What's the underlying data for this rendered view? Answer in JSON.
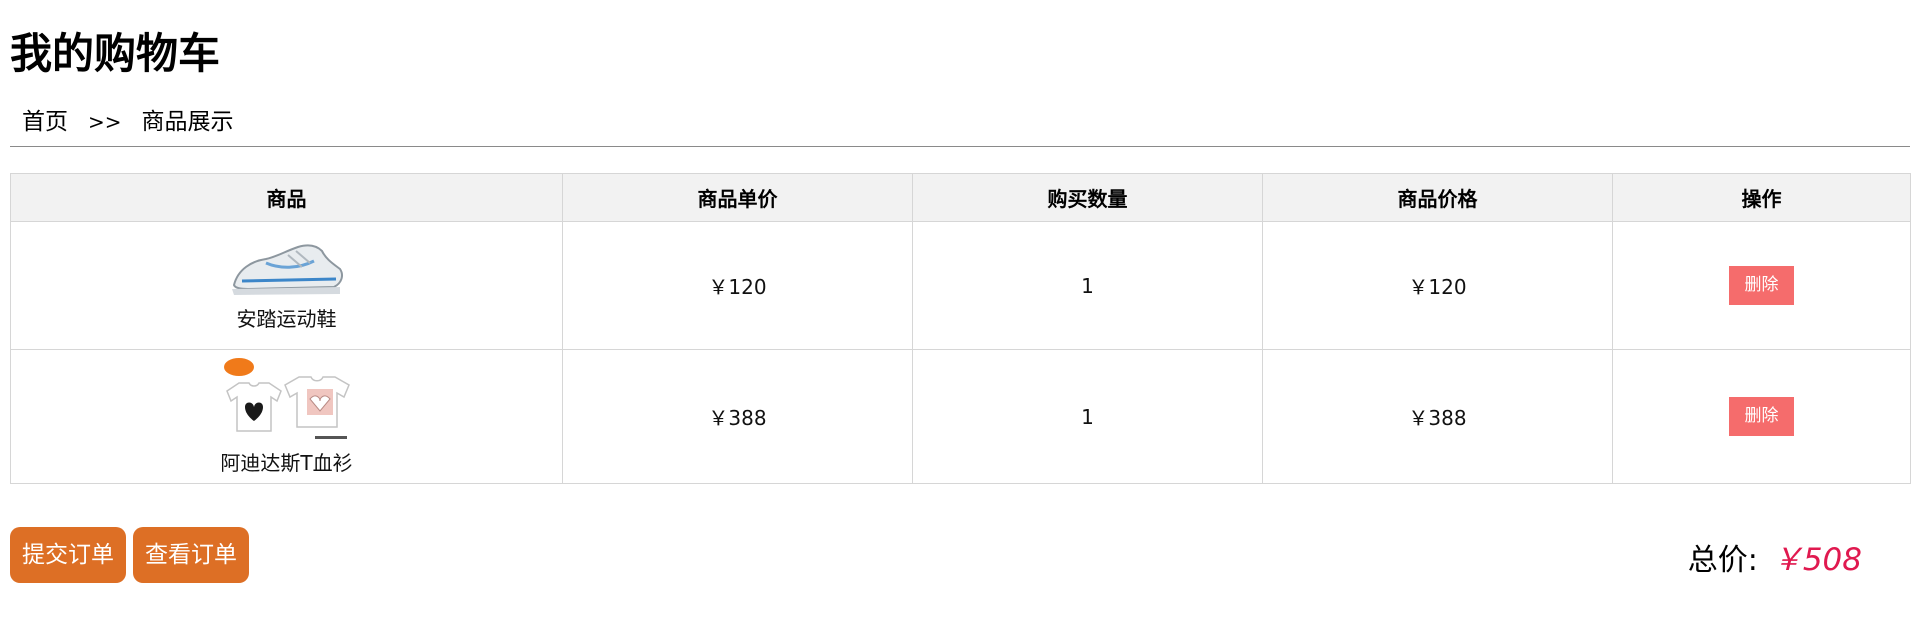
{
  "header": {
    "title": "我的购物车"
  },
  "breadcrumb": {
    "home": "首页",
    "separator": ">>",
    "current": "商品展示"
  },
  "table": {
    "columns": [
      "商品",
      "商品单价",
      "购买数量",
      "商品价格",
      "操作"
    ],
    "rows": [
      {
        "name": "安踏运动鞋",
        "image": "sneaker-image",
        "unit_price": "￥120",
        "quantity": "1",
        "total_price": "￥120",
        "action": "删除"
      },
      {
        "name": "阿迪达斯T血衫",
        "image": "tshirt-image",
        "unit_price": "￥388",
        "quantity": "1",
        "total_price": "￥388",
        "action": "删除"
      }
    ]
  },
  "actions": {
    "submit_order": "提交订单",
    "view_order": "查看订单"
  },
  "summary": {
    "total_label": "总价:",
    "total_value": "￥508"
  },
  "colors": {
    "delete_button": "#f56c6c",
    "order_button": "#dd6f25",
    "total_value": "#e0194f",
    "header_bg": "#f2f2f2"
  }
}
